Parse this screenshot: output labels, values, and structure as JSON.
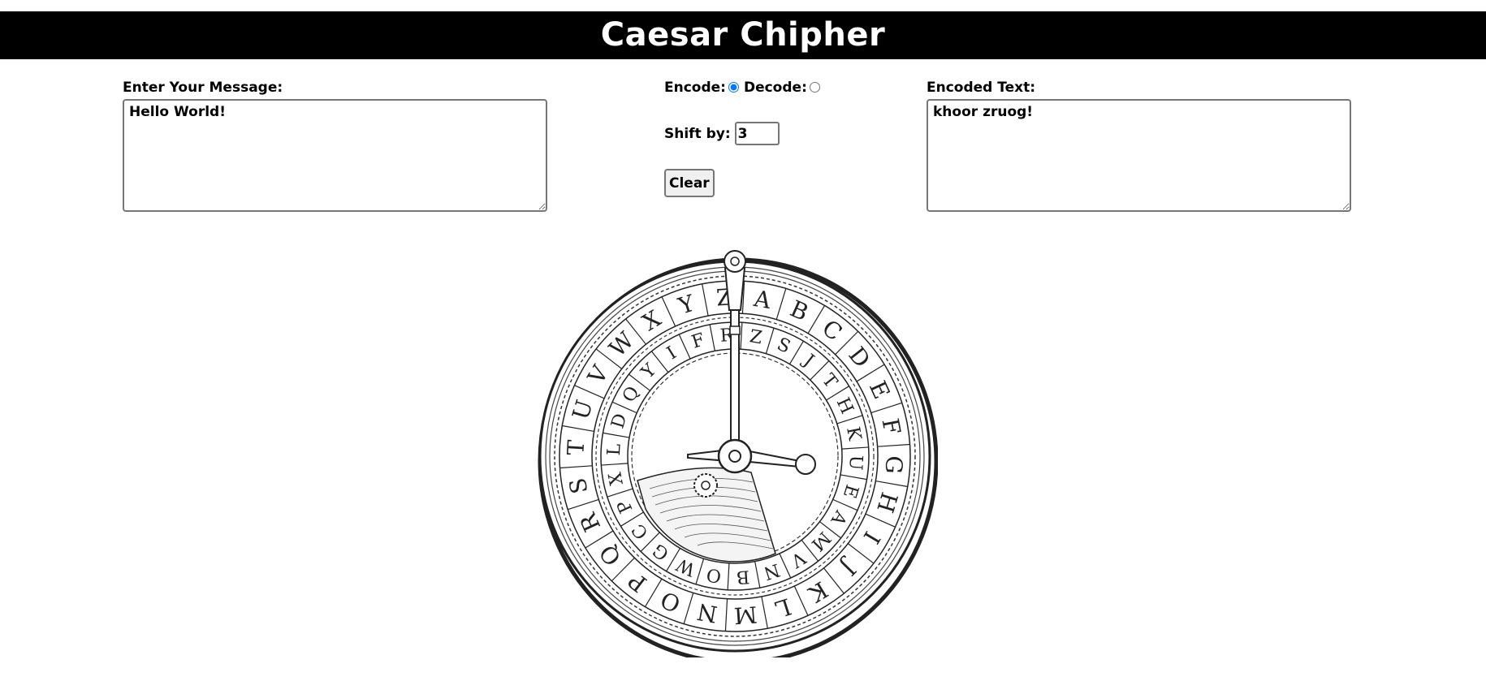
{
  "header": {
    "title": "Caesar Chipher"
  },
  "input": {
    "label": "Enter Your Message:",
    "value": "Hello World!"
  },
  "controls": {
    "encode_label": "Encode:",
    "decode_label": "Decode:",
    "mode_selected": "encode",
    "shift_label": "Shift by:",
    "shift_value": "3",
    "clear_label": "Clear"
  },
  "output": {
    "label": "Encoded Text:",
    "value": "khoor zruog!"
  },
  "disk": {
    "outer_letters": [
      "A",
      "B",
      "C",
      "D",
      "E",
      "F",
      "G",
      "H",
      "I",
      "J",
      "K",
      "L",
      "M",
      "N",
      "O",
      "P",
      "Q",
      "R",
      "S",
      "T",
      "U",
      "V",
      "W",
      "X",
      "Y",
      "Z"
    ],
    "inner_letters": [
      "Z",
      "S",
      "J",
      "T",
      "H",
      "K",
      "U",
      "E",
      "A",
      "M",
      "V",
      "N",
      "B",
      "O",
      "W",
      "G",
      "C",
      "P",
      "X",
      "L",
      "D",
      "Q",
      "Y",
      "I",
      "F",
      "R"
    ]
  }
}
